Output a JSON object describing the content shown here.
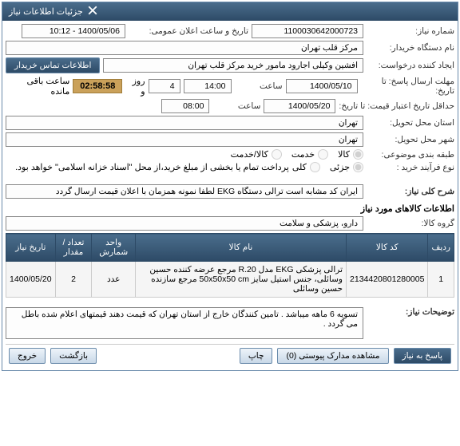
{
  "header": {
    "title": "جزئیات اطلاعات نیاز"
  },
  "labels": {
    "need_no": "شماره نیاز:",
    "announce_dt": "تاریخ و ساعت اعلان عمومی:",
    "buyer": "نام دستگاه خریدار:",
    "requester": "ایجاد کننده درخواست:",
    "supplier_contact_btn": "اطلاعات تماس خریدار",
    "deadline": "مهلت ارسال پاسخ: تا تاریخ:",
    "hour": "ساعت",
    "day_hour": "روز و",
    "remaining": "ساعت باقی مانده",
    "price_valid": "حداقل تاریخ اعتبار قیمت: تا تاریخ:",
    "exec_province": "استان محل تحویل:",
    "exec_city": "شهر محل تحویل:",
    "subject_cat": "طبقه بندی موضوعی:",
    "purchase_type": "نوع فرآیند خرید :",
    "payment_note": "پرداخت تمام یا بخشی از مبلغ خرید،از محل \"اسناد خزانه اسلامی\" خواهد بود.",
    "need_title": "شرح کلی نیاز:",
    "items_info": "اطلاعات کالاهای مورد نیاز",
    "group": "گروه کالا:",
    "notes": "توضیحات نیاز:"
  },
  "values": {
    "need_no": "1100030642000723",
    "announce_dt": "1400/05/06 - 10:12",
    "buyer": "مرکز قلب تهران",
    "requester": "افشین وکیلی اجارود مامور خرید مرکز قلب تهران",
    "deadline_date": "1400/05/10",
    "deadline_time": "14:00",
    "days": "4",
    "timer": "02:58:58",
    "price_valid_date": "1400/05/20",
    "price_valid_time": "08:00",
    "province": "تهران",
    "city": "تهران",
    "need_title": "ایران کد مشابه است ترالی دستگاه EKG لطفا نمونه همزمان با اعلان قیمت ارسال گردد",
    "group": "دارو، پزشکی و سلامت",
    "notes": "تسویه 6 ماهه میباشد . تامین کنندگان خارج از استان تهران که قیمت دهند قیمتهای اعلام شده باطل می گردد ."
  },
  "radios": {
    "goods": "کالا",
    "service": "خدمت",
    "both": "کالا/خدمت",
    "partial": "جزئی",
    "full": "کلی"
  },
  "table": {
    "headers": [
      "ردیف",
      "کد کالا",
      "نام کالا",
      "واحد شمارش",
      "تعداد / مقدار",
      "تاریخ نیاز"
    ],
    "row": {
      "idx": "1",
      "code": "2134420801280005",
      "name": "ترالی پزشکی EKG مدل R.20 مرجع عرضه کننده حسین وسائلی، جنس استیل سایز 50x50x50 cm مرجع سازنده حسین وسائلی",
      "unit": "عدد",
      "qty": "2",
      "date": "1400/05/20"
    }
  },
  "footer": {
    "reply": "پاسخ به نیاز",
    "attachments": "مشاهده مدارک پیوستی (0)",
    "print": "چاپ",
    "back": "بازگشت",
    "exit": "خروج"
  }
}
